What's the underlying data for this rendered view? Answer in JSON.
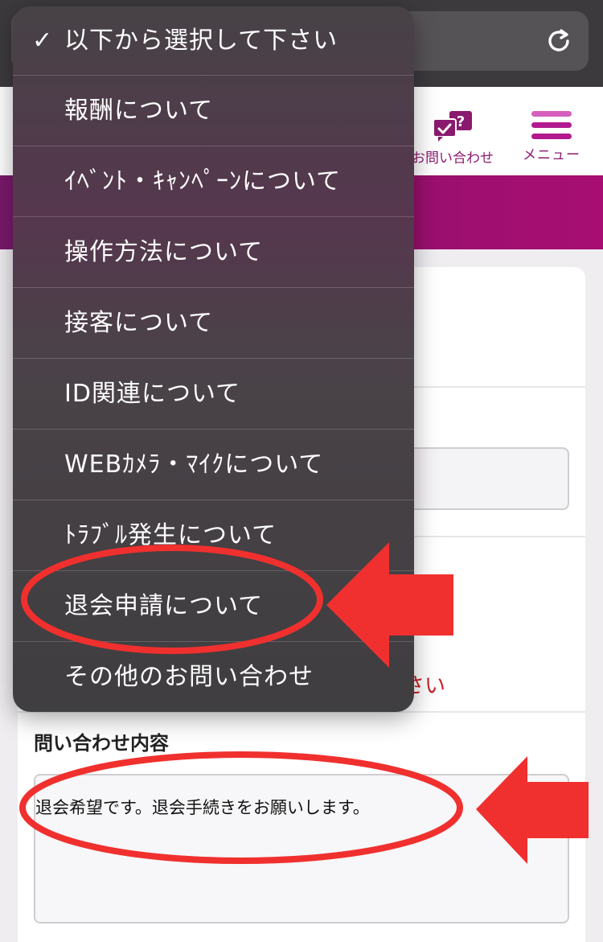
{
  "site_header": {
    "contact_label": "お問い合わせ",
    "menu_label": "メニュー"
  },
  "dropdown": {
    "selected_index": 0,
    "items": [
      "以下から選択して下さい",
      "報酬について",
      "ｲﾍﾞﾝﾄ・ｷｬﾝﾍﾟｰﾝについて",
      "操作方法について",
      "接客について",
      "ID関連について",
      "WEBｶﾒﾗ・ﾏｲｸについて",
      "ﾄﾗﾌﾞﾙ発生について",
      "退会申請について",
      "その他のお問い合わせ"
    ]
  },
  "form": {
    "red_note_fragment": "さい",
    "inquiry_title": "問い合わせ内容",
    "inquiry_value": "退会希望です。退会手続きをお願いします。"
  },
  "colors": {
    "brand_purple": "#96106c",
    "annotation_red": "#f0302e"
  },
  "icons": {
    "reload": "reload-icon",
    "contact": "chat-question-icon",
    "menu": "hamburger-icon",
    "check": "checkmark-icon"
  }
}
